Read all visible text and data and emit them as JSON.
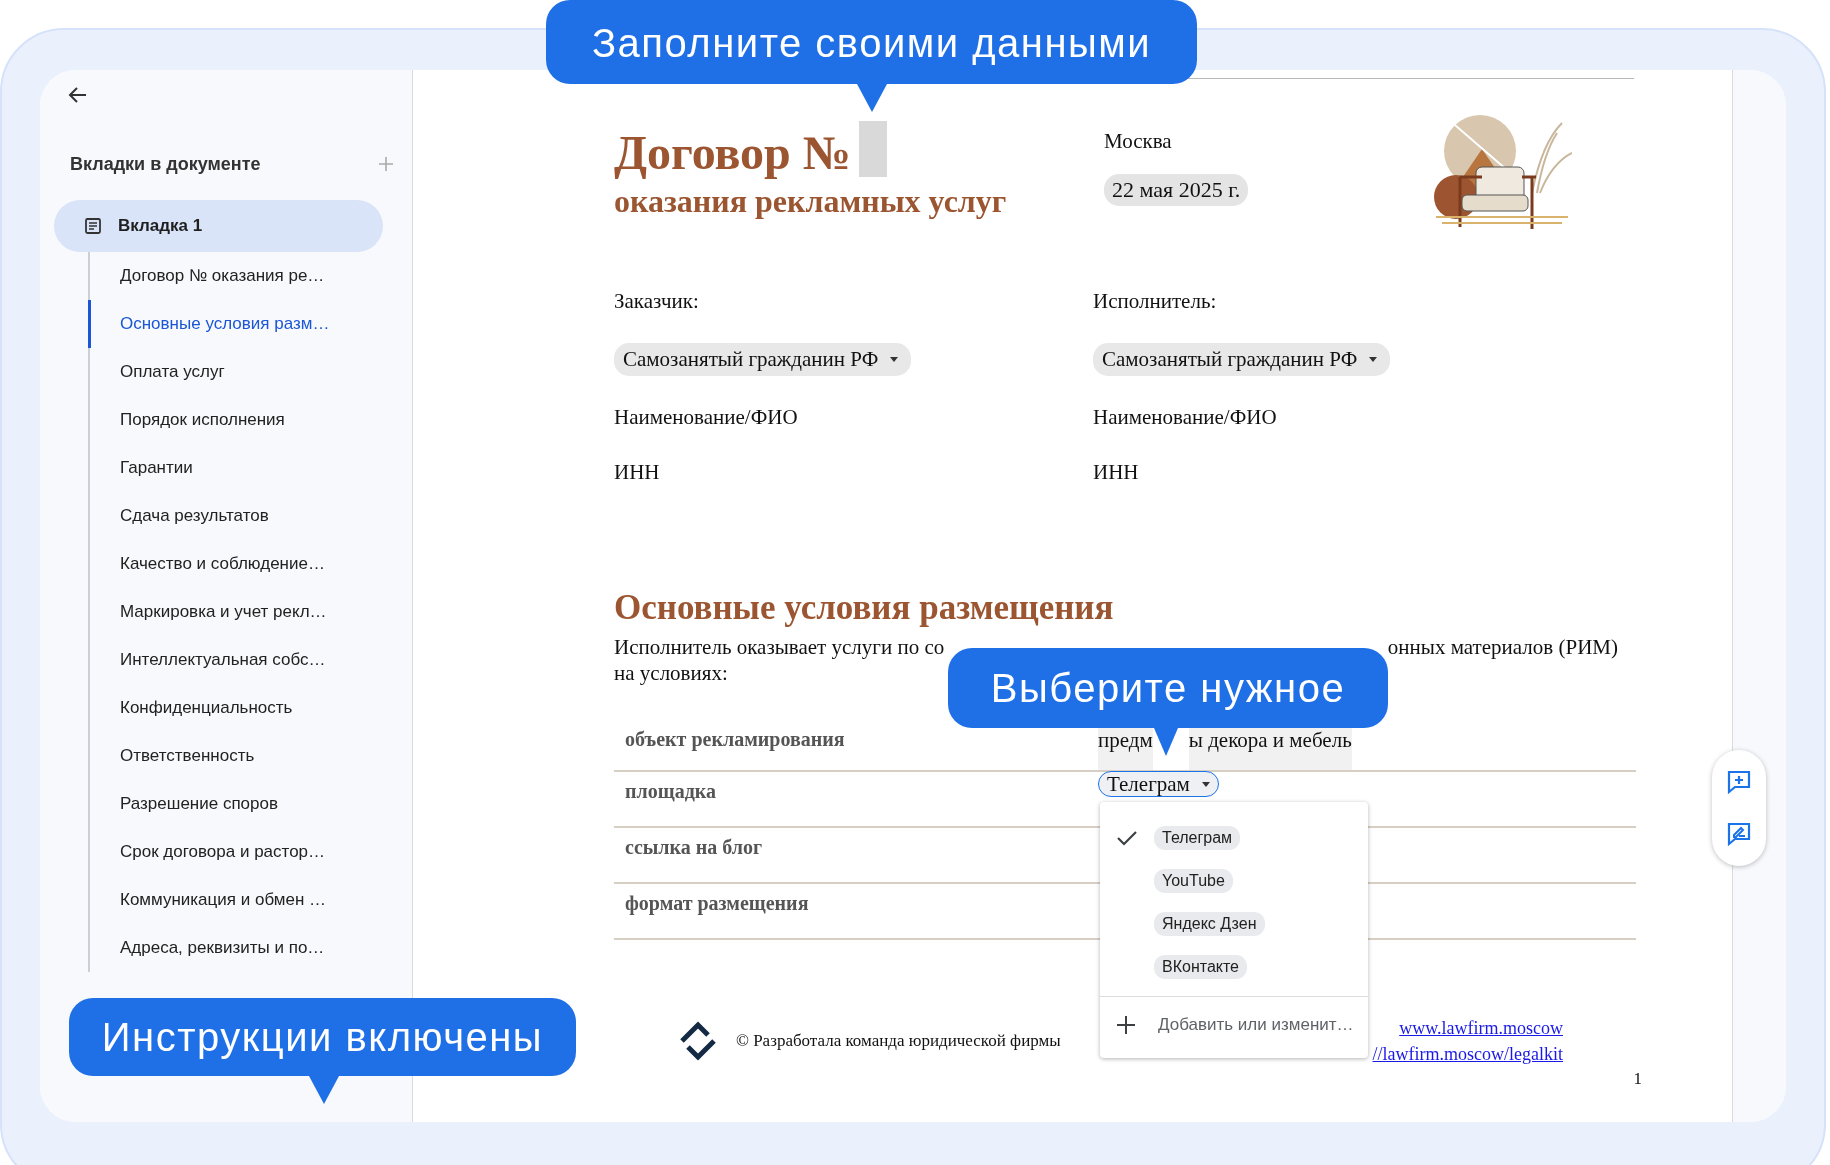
{
  "callouts": {
    "top": "Заполните своими данными",
    "middle": "Выберите нужное",
    "bottom": "Инструкции включены"
  },
  "sidebar": {
    "title": "Вкладки в документе",
    "tabs": [
      {
        "label": "Вкладка 1",
        "selected": true,
        "children": [
          {
            "label": "Договор № оказания ре…",
            "selected": false
          },
          {
            "label": "Основные условия разм…",
            "selected": true
          },
          {
            "label": "Оплата услуг",
            "selected": false
          },
          {
            "label": "Порядок исполнения",
            "selected": false
          },
          {
            "label": "Гарантии",
            "selected": false
          },
          {
            "label": "Сдача результатов",
            "selected": false
          },
          {
            "label": "Качество и соблюдение…",
            "selected": false
          },
          {
            "label": "Маркировка и учет рекл…",
            "selected": false
          },
          {
            "label": "Интеллектуальная собс…",
            "selected": false
          },
          {
            "label": "Конфиденциальность",
            "selected": false
          },
          {
            "label": "Ответственность",
            "selected": false
          },
          {
            "label": "Разрешение споров",
            "selected": false
          },
          {
            "label": "Срок договора и растор…",
            "selected": false
          },
          {
            "label": "Коммуникация и обмен …",
            "selected": false
          },
          {
            "label": "Адреса, реквизиты и по…",
            "selected": false
          }
        ]
      }
    ]
  },
  "document": {
    "title": "Договор №",
    "subtitle": "оказания рекламных услуг",
    "city": "Москва",
    "date": "22 мая 2025 г.",
    "parties": [
      {
        "role": "Заказчик:",
        "type": "Самозанятый гражданин РФ",
        "name_label": "Наименование/ФИО",
        "inn_label": "ИНН"
      },
      {
        "role": "Исполнитель:",
        "type": "Самозанятый гражданин РФ",
        "name_label": "Наименование/ФИО",
        "inn_label": "ИНН"
      }
    ],
    "section_heading": "Основные условия размещения",
    "intro_parts": [
      "Исполнитель оказывает  услуги по со",
      "онных материалов (РИМ)"
    ],
    "intro_line2": "на условиях:",
    "terms": [
      {
        "kind": "text",
        "label": "объект рекламирования",
        "value_parts": [
          "предм",
          "ы декора и мебель"
        ]
      },
      {
        "kind": "dropdown",
        "label": "площадка",
        "value": "Телеграм",
        "open": true
      },
      {
        "kind": "empty",
        "label": "ссылка на блог"
      },
      {
        "kind": "empty",
        "label": "формат размещения"
      }
    ],
    "dropdown_menu": {
      "options": [
        {
          "label": "Телеграм",
          "selected": true
        },
        {
          "label": "YouTube",
          "selected": false
        },
        {
          "label": "Яндекс Дзен",
          "selected": false
        },
        {
          "label": "ВКонтакте",
          "selected": false
        }
      ],
      "action": "Добавить или изменит…"
    },
    "footer": {
      "credit": "© Разработала команда юридической фирмы",
      "links": [
        "www.lawfirm.moscow",
        "//lawfirm.moscow/legalkit"
      ],
      "page_number": "1"
    }
  }
}
